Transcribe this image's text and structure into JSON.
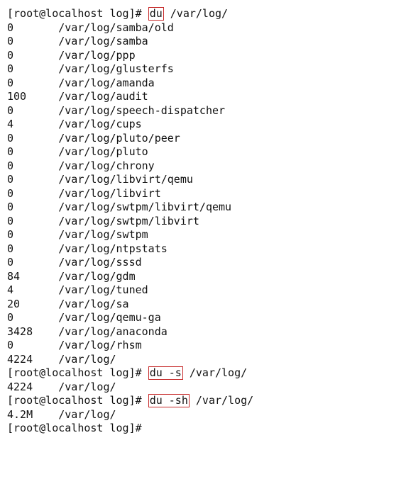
{
  "prompt": "[root@localhost log]# ",
  "cmd1": {
    "name": "du",
    "arg": " /var/log/"
  },
  "rows": [
    {
      "size": "0",
      "path": "/var/log/samba/old"
    },
    {
      "size": "0",
      "path": "/var/log/samba"
    },
    {
      "size": "0",
      "path": "/var/log/ppp"
    },
    {
      "size": "0",
      "path": "/var/log/glusterfs"
    },
    {
      "size": "0",
      "path": "/var/log/amanda"
    },
    {
      "size": "100",
      "path": "/var/log/audit"
    },
    {
      "size": "0",
      "path": "/var/log/speech-dispatcher"
    },
    {
      "size": "4",
      "path": "/var/log/cups"
    },
    {
      "size": "0",
      "path": "/var/log/pluto/peer"
    },
    {
      "size": "0",
      "path": "/var/log/pluto"
    },
    {
      "size": "0",
      "path": "/var/log/chrony"
    },
    {
      "size": "0",
      "path": "/var/log/libvirt/qemu"
    },
    {
      "size": "0",
      "path": "/var/log/libvirt"
    },
    {
      "size": "0",
      "path": "/var/log/swtpm/libvirt/qemu"
    },
    {
      "size": "0",
      "path": "/var/log/swtpm/libvirt"
    },
    {
      "size": "0",
      "path": "/var/log/swtpm"
    },
    {
      "size": "0",
      "path": "/var/log/ntpstats"
    },
    {
      "size": "0",
      "path": "/var/log/sssd"
    },
    {
      "size": "84",
      "path": "/var/log/gdm"
    },
    {
      "size": "4",
      "path": "/var/log/tuned"
    },
    {
      "size": "20",
      "path": "/var/log/sa"
    },
    {
      "size": "0",
      "path": "/var/log/qemu-ga"
    },
    {
      "size": "3428",
      "path": "/var/log/anaconda"
    },
    {
      "size": "0",
      "path": "/var/log/rhsm"
    },
    {
      "size": "4224",
      "path": "/var/log/"
    }
  ],
  "cmd2": {
    "name": "du -s",
    "arg": " /var/log/",
    "out_size": "4224",
    "out_path": "/var/log/"
  },
  "cmd3": {
    "name": "du -sh",
    "arg": " /var/log/",
    "out_size": "4.2M",
    "out_path": "/var/log/"
  }
}
